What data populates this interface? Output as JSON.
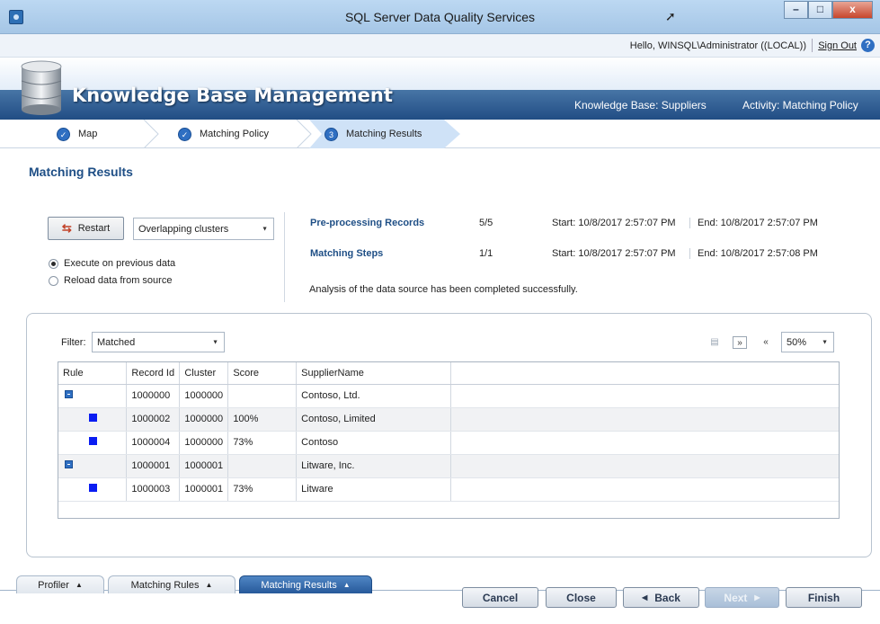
{
  "window": {
    "title": "SQL Server Data Quality Services",
    "buttons": {
      "minimize": "–",
      "maximize": "□",
      "close": "x"
    }
  },
  "userbar": {
    "greeting": "Hello, WINSQL\\Administrator ((LOCAL))",
    "sign_out": "Sign Out",
    "help": "?"
  },
  "banner": {
    "title": "Knowledge Base Management",
    "knowledge_base": "Knowledge Base: Suppliers",
    "activity": "Activity: Matching Policy"
  },
  "steps": [
    {
      "label": "Map",
      "marker": "✓",
      "state": "done"
    },
    {
      "label": "Matching Policy",
      "marker": "✓",
      "state": "done"
    },
    {
      "label": "Matching Results",
      "marker": "3",
      "state": "active"
    }
  ],
  "page": {
    "title": "Matching Results"
  },
  "controls": {
    "restart_label": "Restart",
    "cluster_mode": "Overlapping clusters",
    "radio_options": [
      {
        "label": "Execute on previous data",
        "selected": true
      },
      {
        "label": "Reload data from source",
        "selected": false
      }
    ]
  },
  "progress": [
    {
      "label": "Pre-processing Records",
      "count": "5/5",
      "start": "Start: 10/8/2017 2:57:07 PM",
      "end": "End: 10/8/2017 2:57:07 PM"
    },
    {
      "label": "Matching Steps",
      "count": "1/1",
      "start": "Start: 10/8/2017 2:57:07 PM",
      "end": "End: 10/8/2017 2:57:08 PM"
    }
  ],
  "status_message": "Analysis of the data source has been completed successfully.",
  "filter": {
    "label": "Filter:",
    "value": "Matched"
  },
  "toolbar": {
    "zoom": "50%",
    "icons": [
      "export-icon",
      "expand-all-icon",
      "collapse-all-icon"
    ]
  },
  "grid": {
    "columns": [
      "Rule",
      "Record Id",
      "Cluster",
      "Score",
      "SupplierName"
    ],
    "rows": [
      {
        "rule": "collapse",
        "record_id": "1000000",
        "cluster": "1000000",
        "score": "",
        "supplier": "Contoso, Ltd."
      },
      {
        "rule": "square",
        "record_id": "1000002",
        "cluster": "1000000",
        "score": "100%",
        "supplier": "Contoso, Limited"
      },
      {
        "rule": "square",
        "record_id": "1000004",
        "cluster": "1000000",
        "score": "73%",
        "supplier": "Contoso"
      },
      {
        "rule": "collapse",
        "record_id": "1000001",
        "cluster": "1000001",
        "score": "",
        "supplier": "Litware, Inc."
      },
      {
        "rule": "square",
        "record_id": "1000003",
        "cluster": "1000001",
        "score": "73%",
        "supplier": "Litware"
      }
    ],
    "rule_color": "#0a1df2"
  },
  "bottom_tabs": [
    {
      "label": "Profiler",
      "active": false
    },
    {
      "label": "Matching Rules",
      "active": false
    },
    {
      "label": "Matching Results",
      "active": true
    }
  ],
  "actions": {
    "cancel": "Cancel",
    "close": "Close",
    "back": "Back",
    "next": "Next",
    "finish": "Finish"
  },
  "colors": {
    "accent": "#2f6fc2",
    "banner": "#214d84",
    "title_text": "#1f4f86"
  }
}
